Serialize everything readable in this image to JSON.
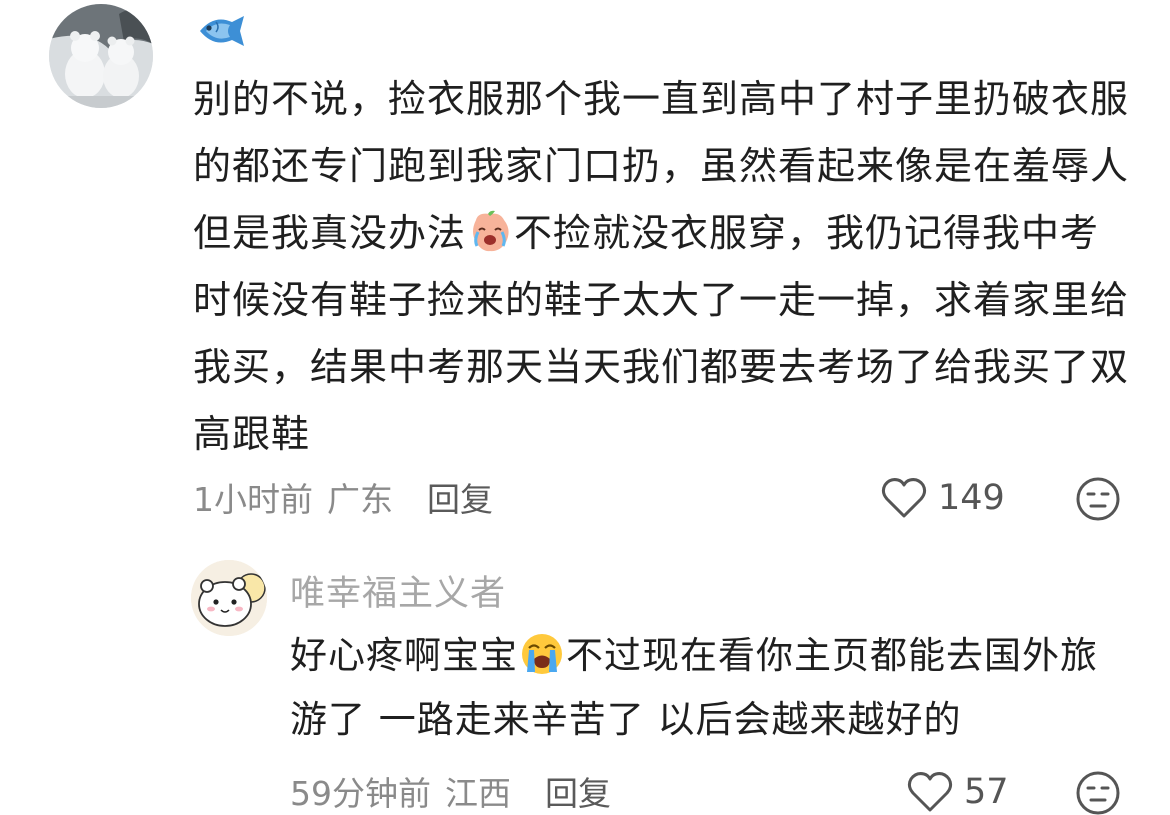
{
  "main_comment": {
    "avatar_icon": "snowman-bears-avatar",
    "name_icon": "fish-emoji-icon",
    "text_part1": "别的不说，捡衣服那个我一直到高中了村子里扔破衣服的都还专门跑到我家门口扔，虽然看起来像是在羞辱人但是我真没办法",
    "inline_emoji": "crying-peach-emoji",
    "text_part2": "不捡就没衣服穿，我仍记得我中考时候没有鞋子捡来的鞋子太大了一走一掉，求着家里给我买，结果中考那天当天我们都要去考场了给我买了双高跟鞋",
    "time": "1小时前",
    "region": "广东",
    "reply_label": "回复",
    "likes": "149"
  },
  "reply_comment": {
    "avatar_icon": "chiikawa-avatar",
    "username": "唯幸福主义者",
    "text_part1": "好心疼啊宝宝",
    "inline_emoji": "loudly-crying-face-emoji",
    "text_part2": "不过现在看你主页都能去国外旅游了 一路走来辛苦了 以后会越来越好的",
    "time": "59分钟前",
    "region": "江西",
    "reply_label": "回复",
    "likes": "57"
  },
  "colors": {
    "text": "#1f1f1f",
    "meta": "#8a8a8a",
    "username": "#a7a7a7",
    "fish": "#3d8fd6"
  }
}
